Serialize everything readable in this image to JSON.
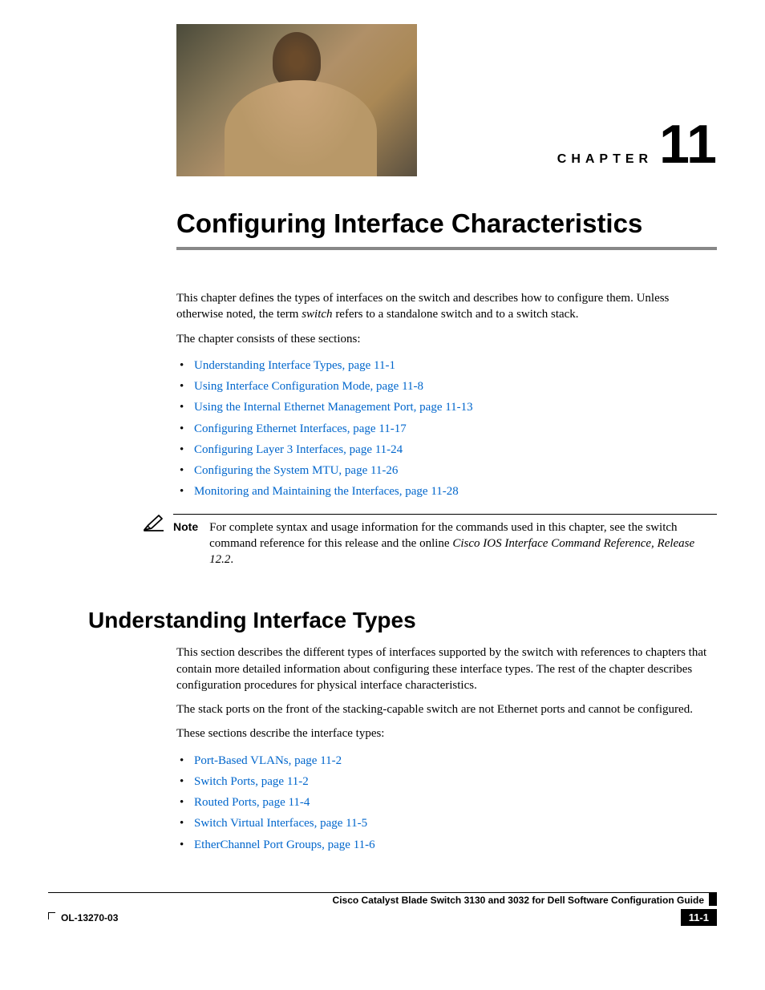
{
  "chapter": {
    "label": "CHAPTER",
    "number": "11",
    "title": "Configuring Interface Characteristics"
  },
  "intro": {
    "p1_a": "This chapter defines the types of interfaces on the switch and describes how to configure them. Unless otherwise noted, the term ",
    "p1_em": "switch",
    "p1_b": " refers to a standalone switch and to a switch stack.",
    "p2": "The chapter consists of these sections:"
  },
  "toc1": [
    "Understanding Interface Types, page 11-1",
    "Using Interface Configuration Mode, page 11-8",
    "Using the Internal Ethernet Management Port, page 11-13",
    "Configuring Ethernet Interfaces, page 11-17",
    "Configuring Layer 3 Interfaces, page 11-24",
    "Configuring the System MTU, page 11-26",
    "Monitoring and Maintaining the Interfaces, page 11-28"
  ],
  "note": {
    "label": "Note",
    "text_a": "For complete syntax and usage information for the commands used in this chapter, see the switch command reference for this release and the online ",
    "text_em": "Cisco IOS Interface Command Reference, Release 12.2",
    "text_b": "."
  },
  "section": {
    "title": "Understanding Interface Types",
    "p1": "This section describes the different types of interfaces supported by the switch with references to chapters that contain more detailed information about configuring these interface types. The rest of the chapter describes configuration procedures for physical interface characteristics.",
    "p2": "The stack ports on the front of the stacking-capable switch are not Ethernet ports and cannot be configured.",
    "p3": "These sections describe the interface types:"
  },
  "toc2": [
    "Port-Based VLANs, page 11-2",
    "Switch Ports, page 11-2",
    "Routed Ports, page 11-4",
    "Switch Virtual Interfaces, page 11-5",
    "EtherChannel Port Groups, page 11-6"
  ],
  "footer": {
    "guide": "Cisco Catalyst Blade Switch 3130 and 3032 for Dell Software Configuration Guide",
    "doc": "OL-13270-03",
    "page": "11-1"
  }
}
